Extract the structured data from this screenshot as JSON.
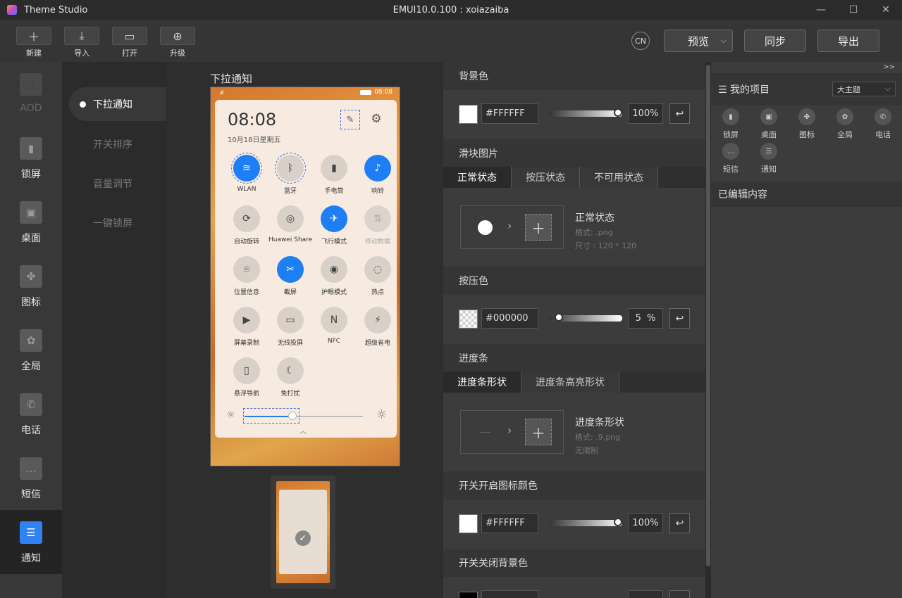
{
  "app": {
    "name": "Theme Studio",
    "window_title": "EMUI10.0.100 : xoiazaiba"
  },
  "toolbar": {
    "buttons": [
      {
        "label": "新建",
        "icon": "plus-icon"
      },
      {
        "label": "导入",
        "icon": "import-icon"
      },
      {
        "label": "打开",
        "icon": "folder-icon"
      },
      {
        "label": "升级",
        "icon": "upgrade-icon"
      }
    ],
    "lang": "CN",
    "preview": "预览",
    "sync": "同步",
    "export": "导出"
  },
  "nav": [
    {
      "label": "AOD",
      "icon": "aod-icon",
      "state": "disabled"
    },
    {
      "label": "锁屏",
      "icon": "lockscreen-icon"
    },
    {
      "label": "桌面",
      "icon": "desktop-icon"
    },
    {
      "label": "图标",
      "icon": "icons-icon"
    },
    {
      "label": "全局",
      "icon": "global-icon"
    },
    {
      "label": "电话",
      "icon": "phone-icon"
    },
    {
      "label": "短信",
      "icon": "message-icon"
    },
    {
      "label": "通知",
      "icon": "notification-icon",
      "state": "active"
    }
  ],
  "subnav": [
    {
      "label": "下拉通知",
      "active": true
    },
    {
      "label": "开关排序"
    },
    {
      "label": "音量调节"
    },
    {
      "label": "一键锁屏"
    }
  ],
  "preview": {
    "title": "下拉通知",
    "status_time": "08:08",
    "signal": ".ııl",
    "clock": "08:08",
    "date": "10月18日星期五",
    "tiles": [
      {
        "label": "WLAN",
        "state": "on",
        "icon": "wifi-icon",
        "glyph": "≋"
      },
      {
        "label": "蓝牙",
        "state": "normal",
        "icon": "bluetooth-icon",
        "glyph": "ᛒ"
      },
      {
        "label": "手电筒",
        "state": "normal",
        "icon": "flashlight-icon",
        "glyph": "▮"
      },
      {
        "label": "响铃",
        "state": "on",
        "icon": "bell-icon",
        "glyph": "♪"
      },
      {
        "label": "自动旋转",
        "state": "normal",
        "icon": "rotate-icon",
        "glyph": "⟳"
      },
      {
        "label": "Huawei Share",
        "state": "normal",
        "icon": "share-icon",
        "glyph": "◎"
      },
      {
        "label": "飞行模式",
        "state": "on",
        "icon": "airplane-icon",
        "glyph": "✈"
      },
      {
        "label": "移动数据",
        "state": "off",
        "icon": "mobile-data-icon",
        "glyph": "⇅"
      },
      {
        "label": "位置信息",
        "state": "normal",
        "icon": "location-icon",
        "glyph": "⌾"
      },
      {
        "label": "截屏",
        "state": "on",
        "icon": "screenshot-icon",
        "glyph": "✂"
      },
      {
        "label": "护眼模式",
        "state": "normal",
        "icon": "eye-icon",
        "glyph": "◉"
      },
      {
        "label": "热点",
        "state": "normal",
        "icon": "hotspot-icon",
        "glyph": "◌"
      },
      {
        "label": "屏幕录制",
        "state": "normal",
        "icon": "record-icon",
        "glyph": "▶"
      },
      {
        "label": "无线投屏",
        "state": "normal",
        "icon": "cast-icon",
        "glyph": "▭"
      },
      {
        "label": "NFC",
        "state": "normal",
        "icon": "nfc-icon",
        "glyph": "N"
      },
      {
        "label": "超级省电",
        "state": "normal",
        "icon": "battery-saver-icon",
        "glyph": "⚡"
      },
      {
        "label": "悬浮导航",
        "state": "normal",
        "icon": "float-nav-icon",
        "glyph": "▯"
      },
      {
        "label": "免打扰",
        "state": "normal",
        "icon": "moon-icon",
        "glyph": "☾"
      }
    ]
  },
  "props": {
    "bg": {
      "title": "背景色",
      "hex": "#FFFFFF",
      "percent": "100%",
      "level": 1.0
    },
    "slider_img": {
      "title": "滑块图片",
      "tabs": [
        "正常状态",
        "按压状态",
        "不可用状态"
      ],
      "name": "正常状态",
      "format": "格式: .png",
      "size": "尺寸 : 120 * 120"
    },
    "press": {
      "title": "按压色",
      "hex": "#000000",
      "percent": "5",
      "unit": "%",
      "level": 0.05
    },
    "progress": {
      "title": "进度条",
      "tabs": [
        "进度条形状",
        "进度条高亮形状"
      ],
      "name": "进度条形状",
      "format": "格式: .9.png",
      "limit": "无限制"
    },
    "switch_on": {
      "title": "开关开启图标颜色",
      "hex": "#FFFFFF",
      "percent": "100%",
      "level": 1.0
    },
    "switch_off": {
      "title": "开关关闭背景色"
    }
  },
  "right": {
    "collapse": ">>",
    "title": "我的项目",
    "select": "大主题",
    "items": [
      {
        "label": "锁屏",
        "icon": "lockscreen-icon"
      },
      {
        "label": "桌面",
        "icon": "desktop-icon"
      },
      {
        "label": "图标",
        "icon": "icons-icon"
      },
      {
        "label": "全局",
        "icon": "global-icon"
      },
      {
        "label": "电话",
        "icon": "phone-icon"
      },
      {
        "label": "短信",
        "icon": "message-icon"
      },
      {
        "label": "通知",
        "icon": "notification-icon"
      }
    ],
    "edited": "已编辑内容"
  }
}
